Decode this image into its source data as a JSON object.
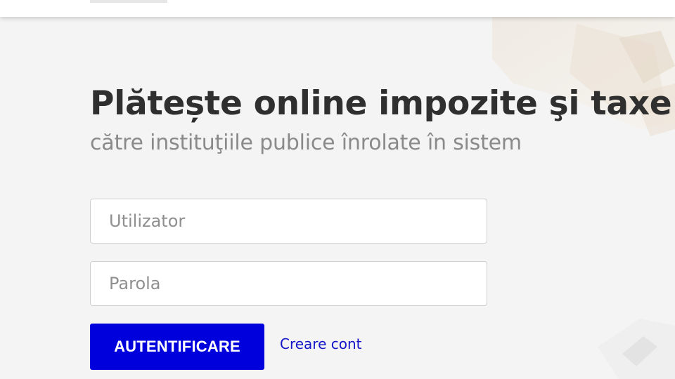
{
  "hero": {
    "title": "Plătește online impozite şi taxe",
    "subtitle": "către instituţiile publice înrolate în sistem"
  },
  "login": {
    "username_placeholder": "Utilizator",
    "password_placeholder": "Parola",
    "submit_label": "AUTENTIFICARE",
    "create_account_label": "Creare cont"
  },
  "colors": {
    "primary_button": "#0000dc",
    "link": "#1414c8",
    "title_text": "#2f2f2f",
    "subtitle_text": "#8a8a8a",
    "page_background": "#f4f4f4"
  }
}
